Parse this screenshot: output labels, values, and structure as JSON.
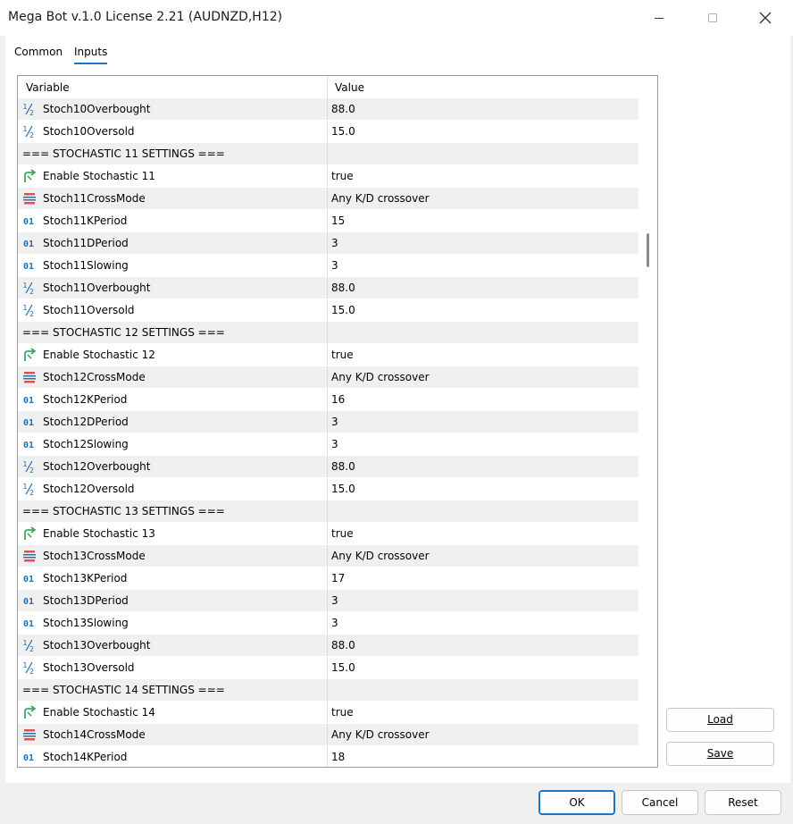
{
  "window": {
    "title": "Mega Bot v.1.0 License 2.21 (AUDNZD,H12)"
  },
  "tabs": [
    {
      "label": "Common",
      "active": false
    },
    {
      "label": "Inputs",
      "active": true
    }
  ],
  "grid": {
    "headers": {
      "variable": "Variable",
      "value": "Value"
    },
    "rows": [
      {
        "icon": "fraction-icon",
        "name": "Stoch10Overbought",
        "value": "88.0"
      },
      {
        "icon": "fraction-icon",
        "name": "Stoch10Oversold",
        "value": "15.0"
      },
      {
        "icon": "",
        "name": "=== STOCHASTIC 11 SETTINGS ===",
        "value": "",
        "section": true
      },
      {
        "icon": "bool-arrow-icon",
        "name": "Enable Stochastic 11",
        "value": "true"
      },
      {
        "icon": "enum-list-icon",
        "name": "Stoch11CrossMode",
        "value": "Any K/D crossover"
      },
      {
        "icon": "integer-icon",
        "name": "Stoch11KPeriod",
        "value": "15"
      },
      {
        "icon": "integer-icon",
        "name": "Stoch11DPeriod",
        "value": "3"
      },
      {
        "icon": "integer-icon",
        "name": "Stoch11Slowing",
        "value": "3"
      },
      {
        "icon": "fraction-icon",
        "name": "Stoch11Overbought",
        "value": "88.0"
      },
      {
        "icon": "fraction-icon",
        "name": "Stoch11Oversold",
        "value": "15.0"
      },
      {
        "icon": "",
        "name": "=== STOCHASTIC 12 SETTINGS ===",
        "value": "",
        "section": true
      },
      {
        "icon": "bool-arrow-icon",
        "name": "Enable Stochastic 12",
        "value": "true"
      },
      {
        "icon": "enum-list-icon",
        "name": "Stoch12CrossMode",
        "value": "Any K/D crossover"
      },
      {
        "icon": "integer-icon",
        "name": "Stoch12KPeriod",
        "value": "16"
      },
      {
        "icon": "integer-icon",
        "name": "Stoch12DPeriod",
        "value": "3"
      },
      {
        "icon": "integer-icon",
        "name": "Stoch12Slowing",
        "value": "3"
      },
      {
        "icon": "fraction-icon",
        "name": "Stoch12Overbought",
        "value": "88.0"
      },
      {
        "icon": "fraction-icon",
        "name": "Stoch12Oversold",
        "value": "15.0"
      },
      {
        "icon": "",
        "name": "=== STOCHASTIC 13 SETTINGS ===",
        "value": "",
        "section": true
      },
      {
        "icon": "bool-arrow-icon",
        "name": "Enable Stochastic 13",
        "value": "true"
      },
      {
        "icon": "enum-list-icon",
        "name": "Stoch13CrossMode",
        "value": "Any K/D crossover"
      },
      {
        "icon": "integer-icon",
        "name": "Stoch13KPeriod",
        "value": "17"
      },
      {
        "icon": "integer-icon",
        "name": "Stoch13DPeriod",
        "value": "3"
      },
      {
        "icon": "integer-icon",
        "name": "Stoch13Slowing",
        "value": "3"
      },
      {
        "icon": "fraction-icon",
        "name": "Stoch13Overbought",
        "value": "88.0"
      },
      {
        "icon": "fraction-icon",
        "name": "Stoch13Oversold",
        "value": "15.0"
      },
      {
        "icon": "",
        "name": "=== STOCHASTIC 14 SETTINGS ===",
        "value": "",
        "section": true
      },
      {
        "icon": "bool-arrow-icon",
        "name": "Enable Stochastic 14",
        "value": "true"
      },
      {
        "icon": "enum-list-icon",
        "name": "Stoch14CrossMode",
        "value": "Any K/D crossover"
      },
      {
        "icon": "integer-icon",
        "name": "Stoch14KPeriod",
        "value": "18"
      }
    ]
  },
  "side_buttons": {
    "load": "Load",
    "save": "Save"
  },
  "footer_buttons": {
    "ok": "OK",
    "cancel": "Cancel",
    "reset": "Reset"
  },
  "colors": {
    "accent": "#1a73c8",
    "icon_blue": "#1f6fb5",
    "icon_green": "#1e9e4a",
    "icon_red": "#d9534f"
  }
}
